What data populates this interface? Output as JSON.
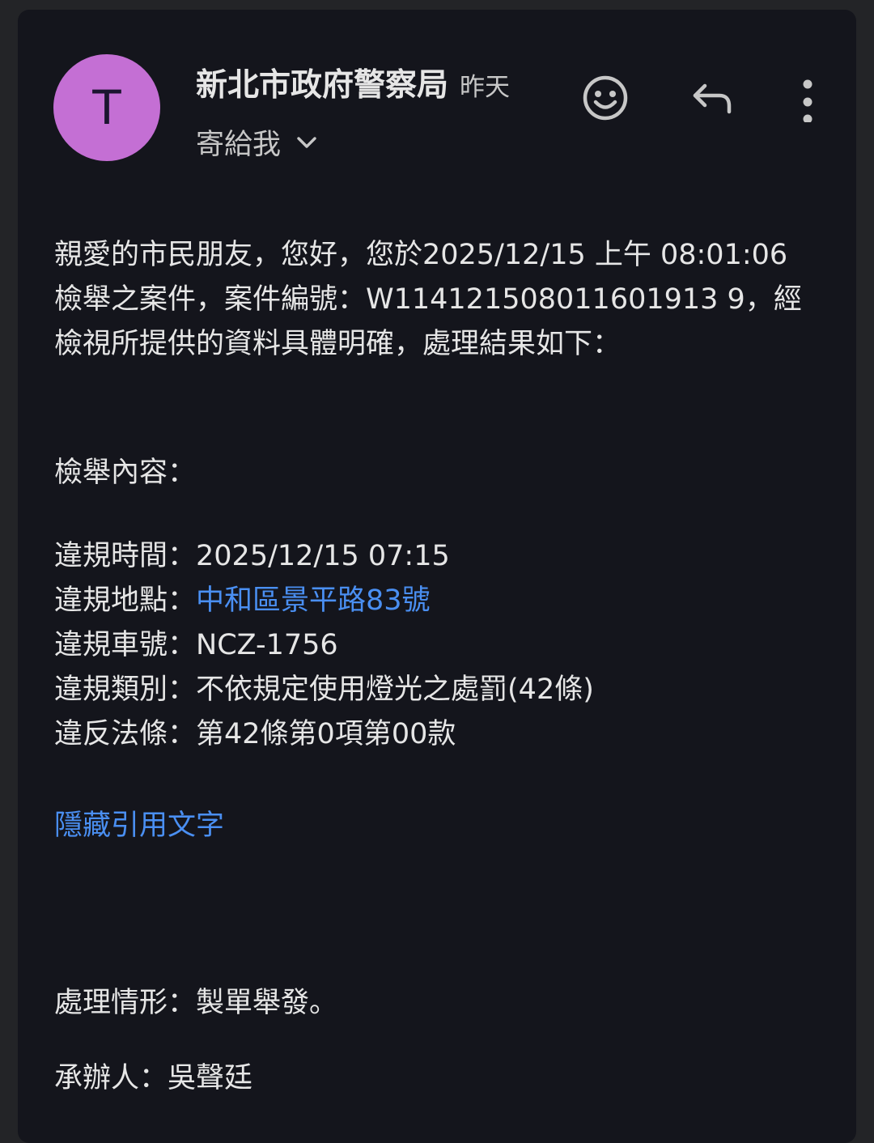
{
  "header": {
    "avatar_letter": "T",
    "avatar_color": "#c46fd4",
    "sender_name": "新北市政府警察局",
    "date": "昨天",
    "recipient": "寄給我",
    "icons": [
      "emoji-reaction-icon",
      "reply-icon",
      "more-vert-icon",
      "chevron-down-icon"
    ]
  },
  "body": {
    "intro_lines": [
      "親愛的市民朋友，您好，您於2025/12/15 上午 08:01:06",
      "檢舉之案件，案件編號：W114121508011601913 9，經",
      "檢視所提供的資料具體明確，處理結果如下："
    ],
    "content_heading": "檢舉內容：",
    "details": {
      "time_label": "違規時間：",
      "time_value": "2025/12/15 07:15",
      "location_label": "違規地點：",
      "location_value": "中和區景平路83號",
      "plate_label": "違規車號：",
      "plate_value": "NCZ-1756",
      "category_label": "違規類別：",
      "category_value": "不依規定使用燈光之處罰(42條)",
      "law_label": "違反法條：",
      "law_value": "第42條第0項第00款"
    },
    "hide_quoted_link": "隱藏引用文字",
    "result_label": "處理情形：",
    "result_value": "製單舉發。",
    "handler_label": "承辦人：",
    "handler_value": "吳聲廷"
  },
  "colors": {
    "background": "#14151c",
    "link": "#4a8ff2",
    "text": "#e6e6e6"
  }
}
